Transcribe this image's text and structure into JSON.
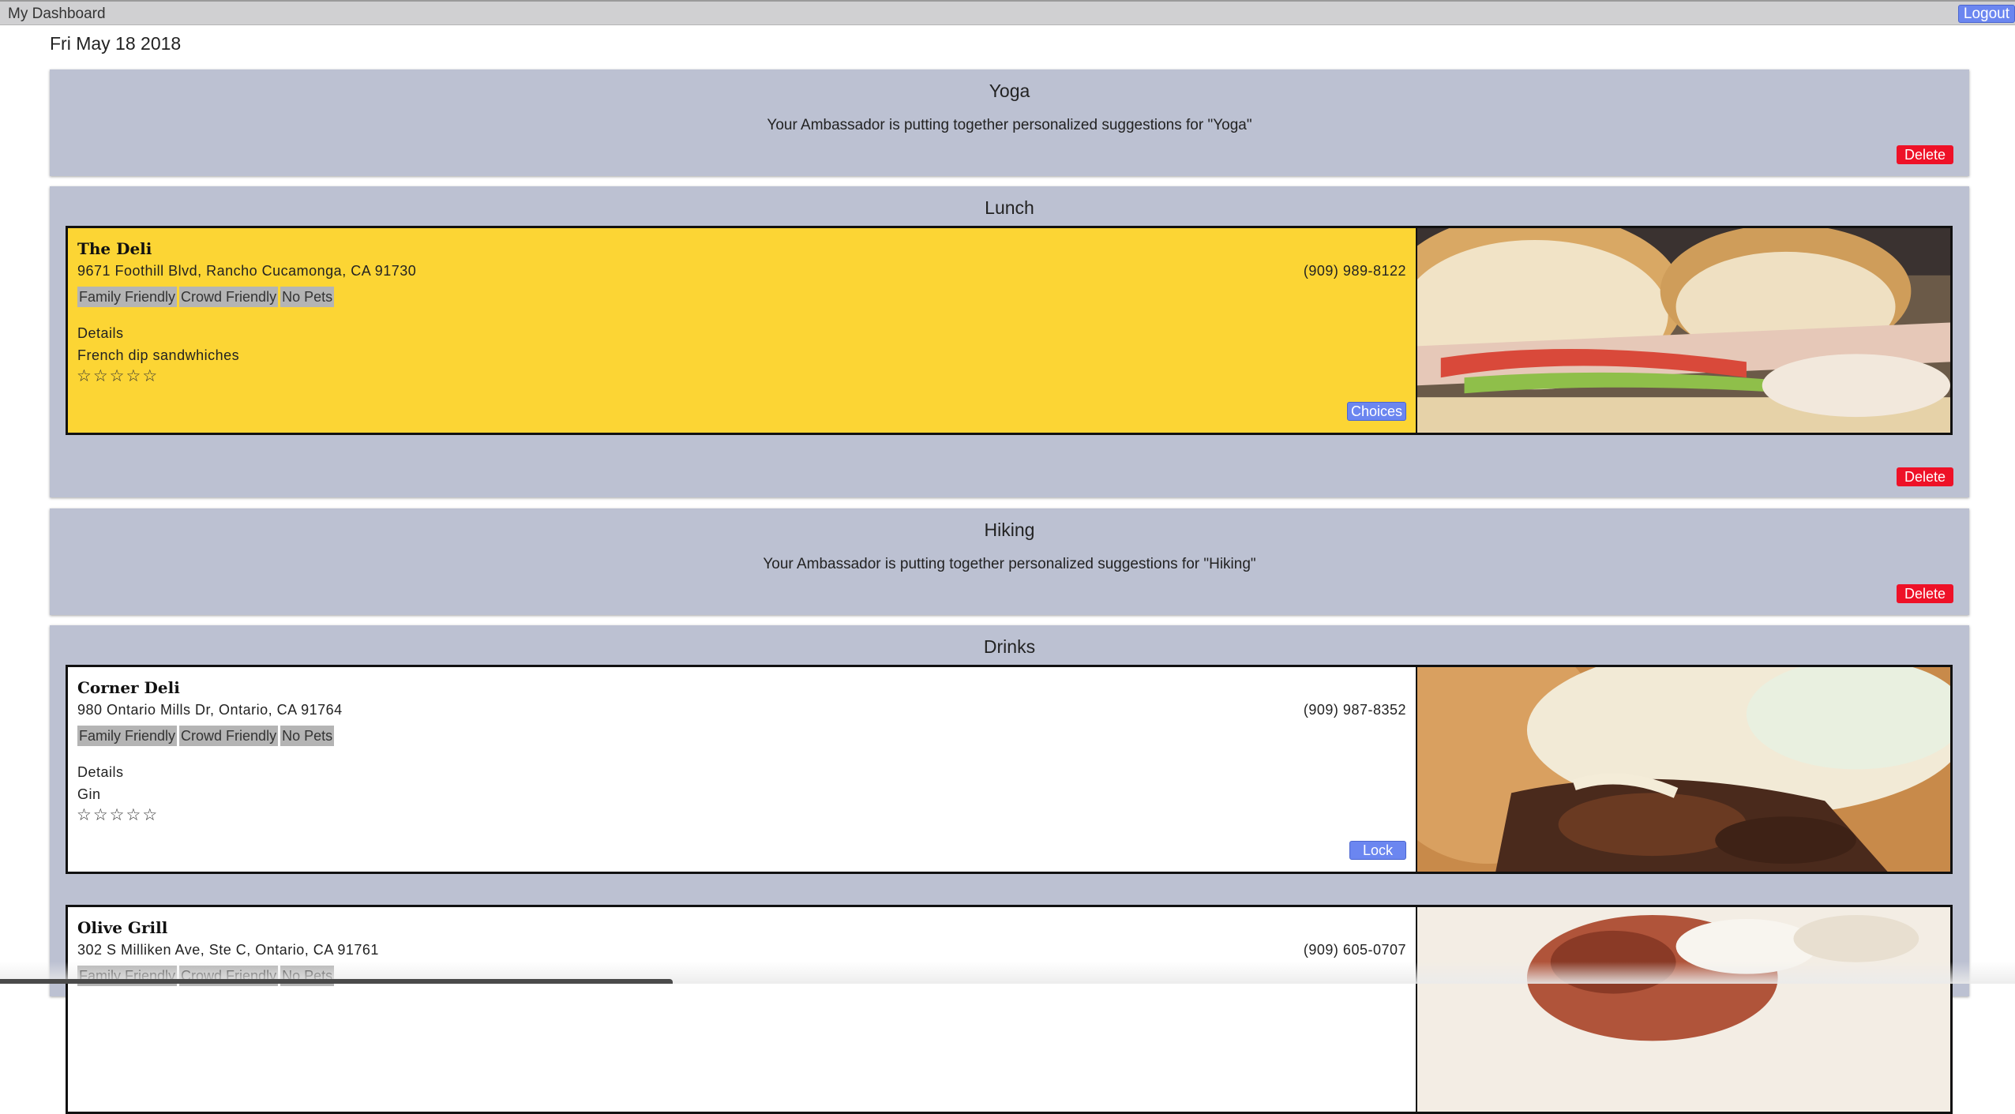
{
  "header": {
    "title": "My Dashboard",
    "logout_label": "Logout"
  },
  "date": "Fri May 18 2018",
  "delete_label": "Delete",
  "events": {
    "yoga": {
      "title": "Yoga",
      "message": "Your Ambassador is putting together personalized suggestions for \"Yoga\""
    },
    "lunch": {
      "title": "Lunch",
      "card": {
        "name": "The Deli",
        "address": "9671 Foothill Blvd, Rancho Cucamonga, CA 91730",
        "phone": "(909) 989-8122",
        "tags": [
          "Family Friendly",
          "Crowd Friendly",
          "No Pets"
        ],
        "details_label": "Details",
        "details": "French dip sandwhiches",
        "rating": 0,
        "button_label": "Choices",
        "image": "sandwich-photo"
      }
    },
    "hiking": {
      "title": "Hiking",
      "message": "Your Ambassador is putting together personalized suggestions for \"Hiking\""
    },
    "drinks": {
      "title": "Drinks",
      "cards": [
        {
          "name": "Corner Deli",
          "address": "980 Ontario Mills Dr, Ontario, CA 91764",
          "phone": "(909) 987-8352",
          "tags": [
            "Family Friendly",
            "Crowd Friendly",
            "No Pets"
          ],
          "details_label": "Details",
          "details": "Gin",
          "rating": 0,
          "button_label": "Lock",
          "image": "cheesesteak-photo"
        },
        {
          "name": "Olive Grill",
          "address": "302 S Milliken Ave, Ste C, Ontario, CA 91761",
          "phone": "(909) 605-0707",
          "tags": [
            "Family Friendly",
            "Crowd Friendly",
            "No Pets"
          ],
          "image": "grill-food-photo"
        }
      ]
    }
  },
  "colors": {
    "panel_bg": "#bcc1d2",
    "locked_card_bg": "#fcd534",
    "delete_red": "#ee1127",
    "button_blue": "#6b86f0"
  }
}
